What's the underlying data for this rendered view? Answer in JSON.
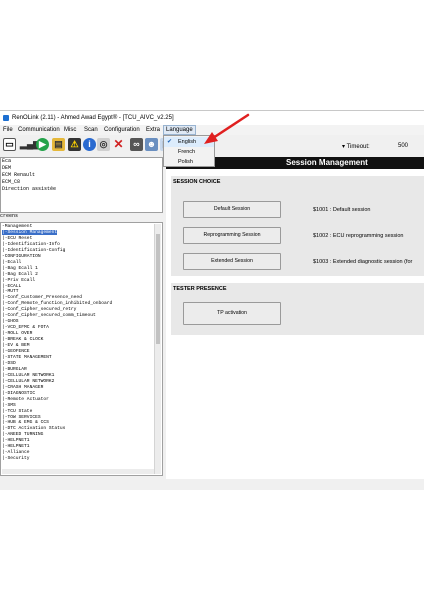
{
  "window": {
    "title": "RenOLink (2.11) - Ahmed Awad Egypt® - [TCU_AIVC_v2.25]"
  },
  "menu": [
    "File",
    "Communication",
    "Misc",
    "Scan",
    "Configuration",
    "Extra",
    "Language"
  ],
  "language_menu": {
    "items": [
      "English",
      "French",
      "Polish"
    ],
    "checked": "English"
  },
  "toolbar": {
    "icons": [
      "new-file-icon",
      "signal-icon",
      "play-icon",
      "folder-icon",
      "warning-icon",
      "info-icon",
      "network-icon",
      "delete-icon",
      "binoculars-icon",
      "users-icon",
      "screen-icon",
      "grid-icon"
    ],
    "timeout_label": "Timeout:",
    "timeout_value": "500"
  },
  "ecu_info": {
    "lines": [
      "Eca",
      "DEM",
      "ECM Renault",
      "ECM_C8",
      "Direction assistée"
    ]
  },
  "screens_label": "creens",
  "tree": {
    "rows": [
      {
        "text": "-Management",
        "selected": false
      },
      {
        "text": "  |-Session Management",
        "selected": true
      },
      {
        "text": "  |-ECU Reset",
        "selected": false
      },
      {
        "text": "  |-Identification-Info",
        "selected": false
      },
      {
        "text": "  |-Identification-Config",
        "selected": false
      },
      {
        "text": "-CONFIGURATION",
        "selected": false
      },
      {
        "text": "  |-Ecall",
        "selected": false
      },
      {
        "text": "  |-Bag Ecall 1",
        "selected": false
      },
      {
        "text": "  |-Bag Ecall 2",
        "selected": false
      },
      {
        "text": "  |-Priv Ecall",
        "selected": false
      },
      {
        "text": "  |-ECALL",
        "selected": false
      },
      {
        "text": "  |-MUTT",
        "selected": false
      },
      {
        "text": "  |-Conf_Customer_Presence_need",
        "selected": false
      },
      {
        "text": "  |-Conf_Remote_function_inhibited_onboard",
        "selected": false
      },
      {
        "text": "  |-Conf_Cipher_secured_retry",
        "selected": false
      },
      {
        "text": "  |-Conf_Cipher_secured_comm_timeout",
        "selected": false
      },
      {
        "text": "  |-GHOS",
        "selected": false
      },
      {
        "text": "  |-VCD_EFMC & FOTA",
        "selected": false
      },
      {
        "text": "  |-ROLL OVER",
        "selected": false
      },
      {
        "text": "  |-BREAK & CLOCK",
        "selected": false
      },
      {
        "text": "  |-EV & BEM",
        "selected": false
      },
      {
        "text": "  |-GEOFENCE",
        "selected": false
      },
      {
        "text": "  |-STATE MANAGEMENT",
        "selected": false
      },
      {
        "text": "  |-DSD",
        "selected": false
      },
      {
        "text": "  |-BURGLAR",
        "selected": false
      },
      {
        "text": "  |-CELLULAR NETWORK1",
        "selected": false
      },
      {
        "text": "  |-CELLULAR NETWORK2",
        "selected": false
      },
      {
        "text": "  |-CRASH MANAGER",
        "selected": false
      },
      {
        "text": "  |-DIAGNOSTIC",
        "selected": false
      },
      {
        "text": "  |-Remote Actuator",
        "selected": false
      },
      {
        "text": "  |-SMS",
        "selected": false
      },
      {
        "text": "  |-TCU State",
        "selected": false
      },
      {
        "text": "  |-TOW SERVICES",
        "selected": false
      },
      {
        "text": "  |-HUB & EMG & CCS",
        "selected": false
      },
      {
        "text": "  |-DTC Activation Status",
        "selected": false
      },
      {
        "text": "  |-ANEED TURNING",
        "selected": false
      },
      {
        "text": "  |-HELPNET1",
        "selected": false
      },
      {
        "text": "  |-HELPNET1",
        "selected": false
      },
      {
        "text": "  |-Alliance",
        "selected": false
      },
      {
        "text": "  |-Security",
        "selected": false
      }
    ]
  },
  "main": {
    "header": "Session Management",
    "session_choice": {
      "title": "SESSION CHOICE",
      "buttons": [
        {
          "label": "Default Session",
          "desc": "$1001 : Default session"
        },
        {
          "label": "Reprogramming Session",
          "desc": "$1002 : ECU reprogramming session"
        },
        {
          "label": "Extended Session",
          "desc": "$1003 : Extended diagnostic session (for"
        }
      ]
    },
    "tester_presence": {
      "title": "TESTER PRESENCE",
      "button": "TP activation"
    }
  },
  "colors": {
    "header_bg": "#111111",
    "selection": "#3a6fc8",
    "annotation_arrow": "#e02020"
  }
}
